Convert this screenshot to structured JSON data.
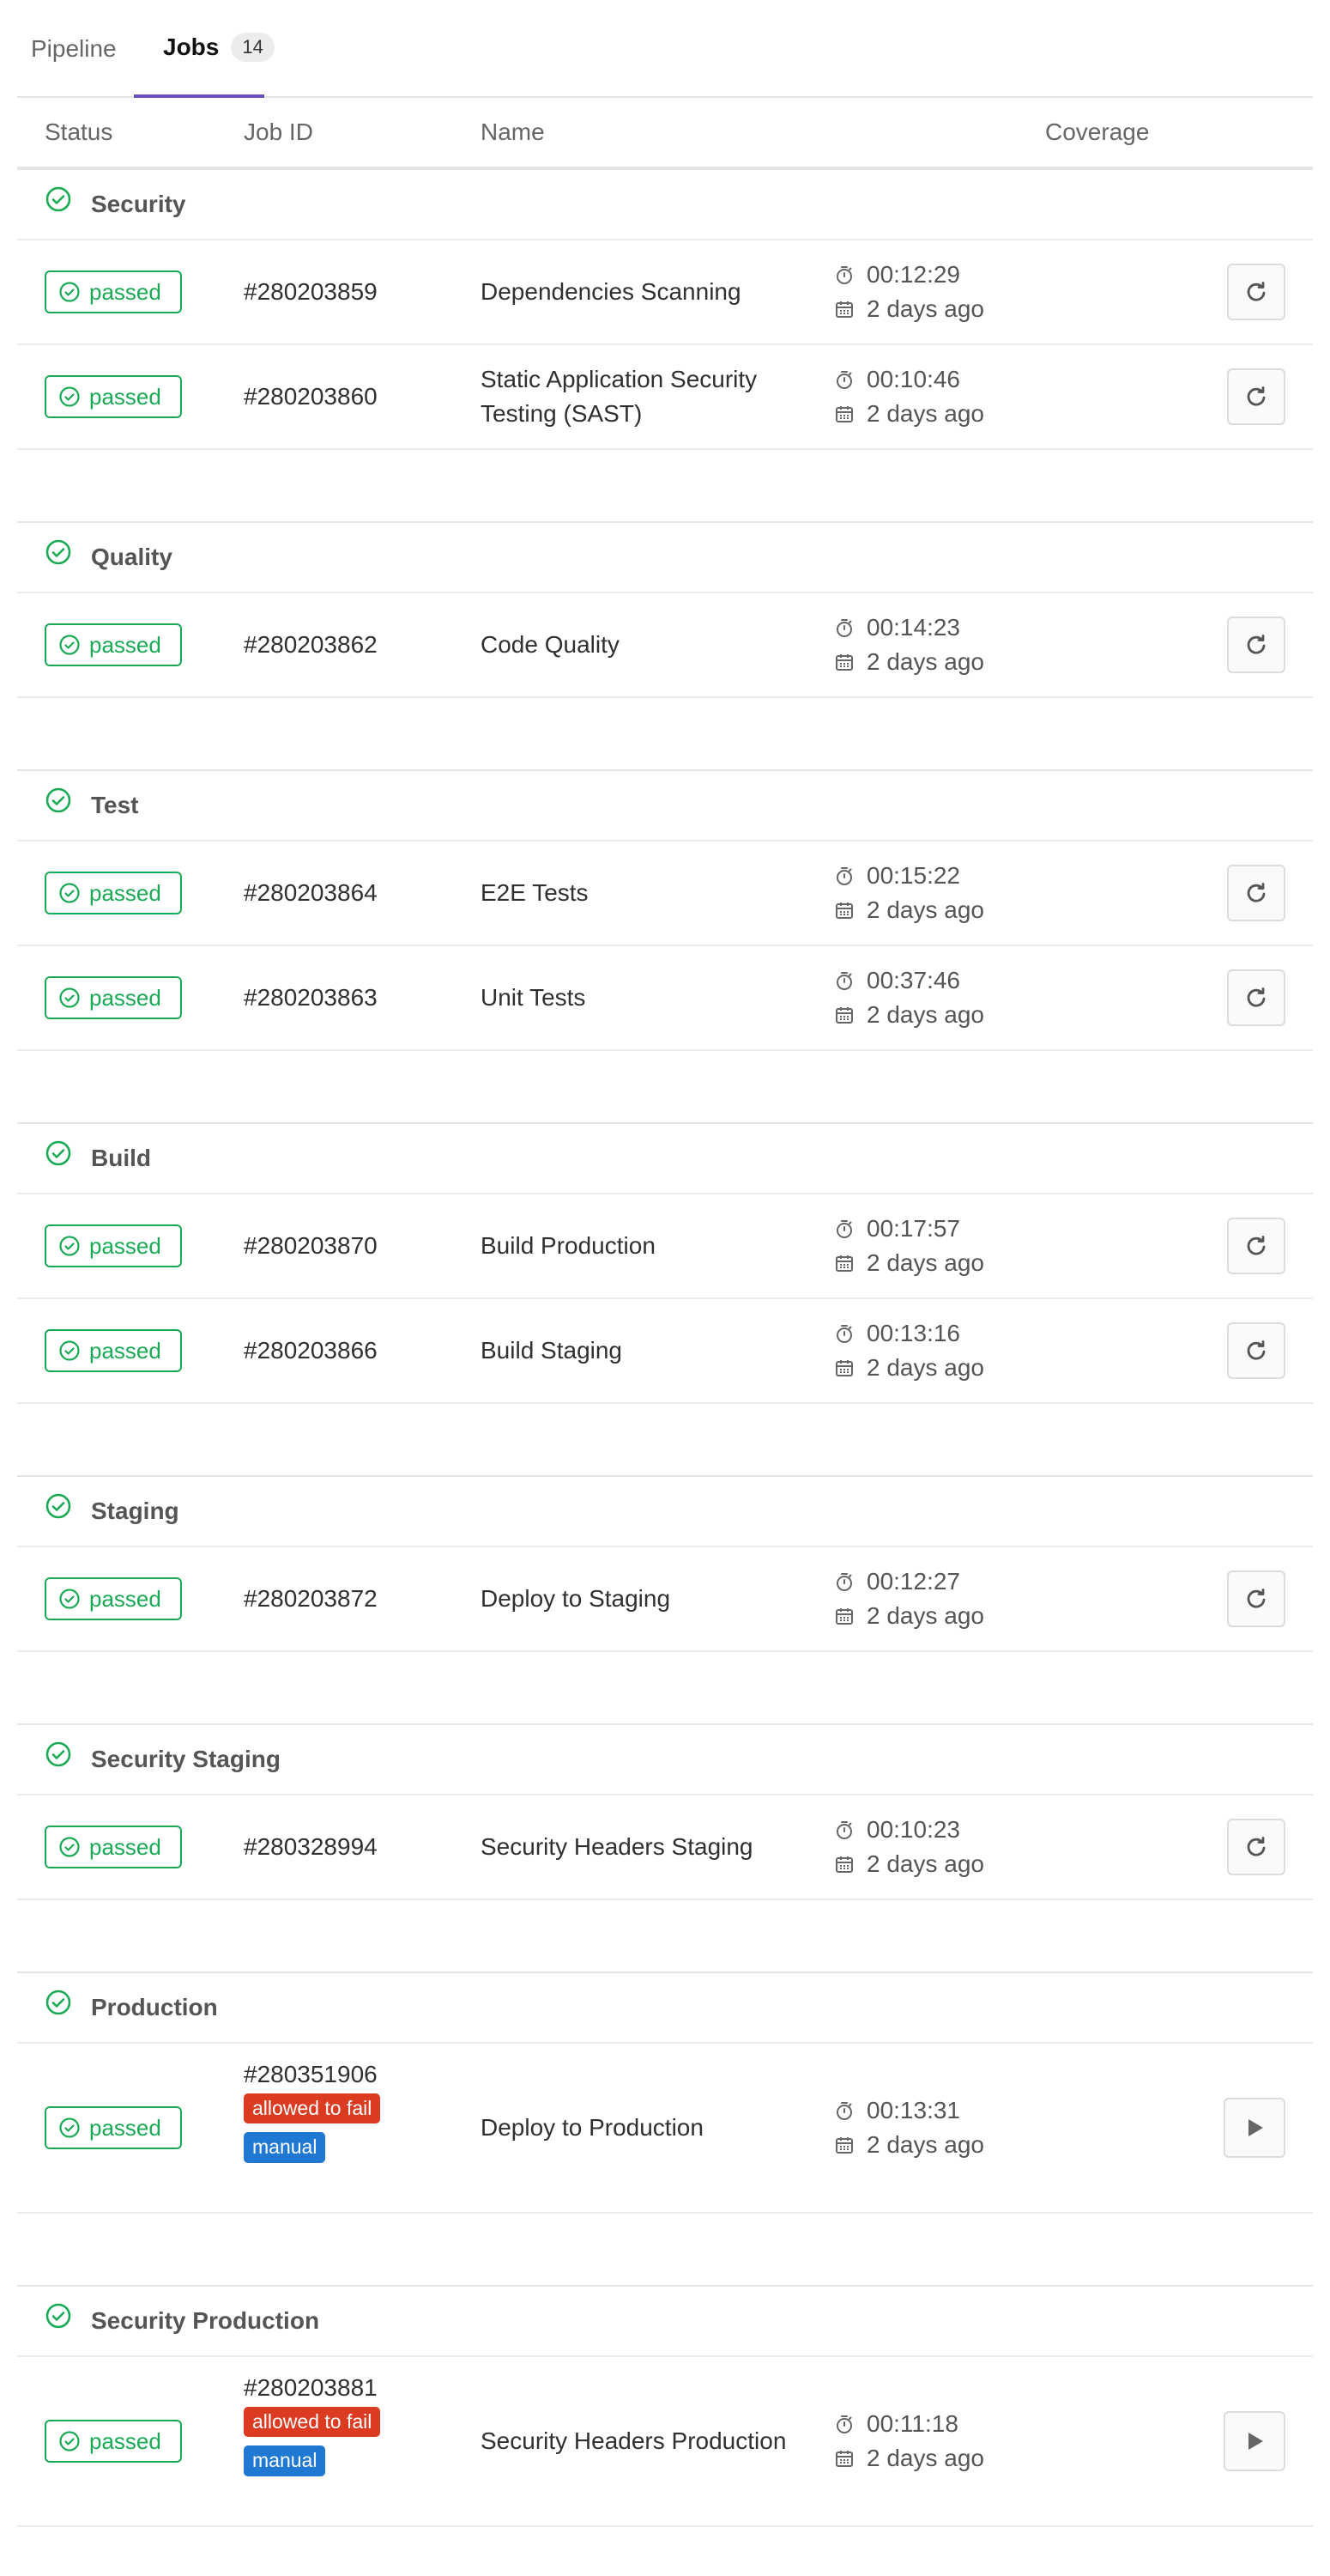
{
  "tabs": {
    "pipeline": "Pipeline",
    "jobs": "Jobs",
    "jobs_count": "14"
  },
  "columns": {
    "status": "Status",
    "job_id": "Job ID",
    "name": "Name",
    "coverage": "Coverage"
  },
  "status_label": "passed",
  "colors": {
    "passed": "#1aaa55",
    "allowed_to_fail": "#db3b21",
    "manual": "#1f78d1",
    "active_tab": "#6b4fbb"
  },
  "stages": [
    {
      "name": "Security",
      "jobs": [
        {
          "id": "#280203859",
          "name": "Dependencies Scanning",
          "duration": "00:12:29",
          "finished": "2 days ago",
          "action": "retry"
        },
        {
          "id": "#280203860",
          "name": "Static Application Security Testing (SAST)",
          "duration": "00:10:46",
          "finished": "2 days ago",
          "action": "retry"
        }
      ]
    },
    {
      "name": "Quality",
      "jobs": [
        {
          "id": "#280203862",
          "name": "Code Quality",
          "duration": "00:14:23",
          "finished": "2 days ago",
          "action": "retry"
        }
      ]
    },
    {
      "name": "Test",
      "jobs": [
        {
          "id": "#280203864",
          "name": "E2E Tests",
          "duration": "00:15:22",
          "finished": "2 days ago",
          "action": "retry"
        },
        {
          "id": "#280203863",
          "name": "Unit Tests",
          "duration": "00:37:46",
          "finished": "2 days ago",
          "action": "retry"
        }
      ]
    },
    {
      "name": "Build",
      "jobs": [
        {
          "id": "#280203870",
          "name": "Build Production",
          "duration": "00:17:57",
          "finished": "2 days ago",
          "action": "retry"
        },
        {
          "id": "#280203866",
          "name": "Build Staging",
          "duration": "00:13:16",
          "finished": "2 days ago",
          "action": "retry"
        }
      ]
    },
    {
      "name": "Staging",
      "jobs": [
        {
          "id": "#280203872",
          "name": "Deploy to Staging",
          "duration": "00:12:27",
          "finished": "2 days ago",
          "action": "retry"
        }
      ]
    },
    {
      "name": "Security Staging",
      "jobs": [
        {
          "id": "#280328994",
          "name": "Security Headers Staging",
          "duration": "00:10:23",
          "finished": "2 days ago",
          "action": "retry"
        }
      ]
    },
    {
      "name": "Production",
      "jobs": [
        {
          "id": "#280351906",
          "name": "Deploy to Production",
          "duration": "00:13:31",
          "finished": "2 days ago",
          "action": "play",
          "allowed_to_fail": "allowed to fail",
          "manual": "manual"
        }
      ]
    },
    {
      "name": "Security Production",
      "jobs": [
        {
          "id": "#280203881",
          "name": "Security Headers Production",
          "duration": "00:11:18",
          "finished": "2 days ago",
          "action": "play",
          "allowed_to_fail": "allowed to fail",
          "manual": "manual"
        }
      ]
    }
  ]
}
